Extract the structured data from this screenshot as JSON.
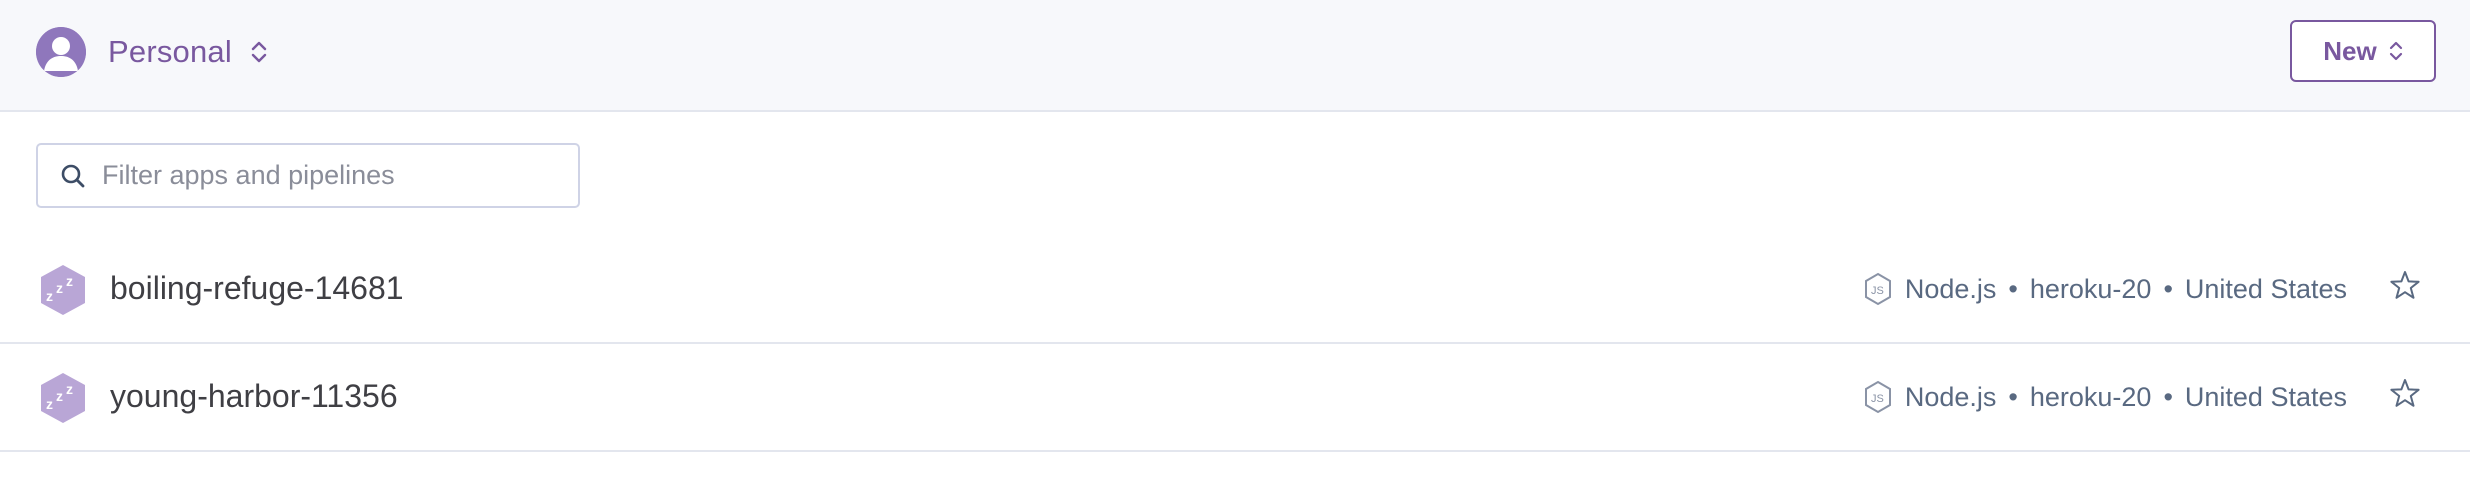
{
  "header": {
    "account_label": "Personal",
    "new_button_label": "New"
  },
  "filter": {
    "placeholder": "Filter apps and pipelines",
    "value": ""
  },
  "apps": [
    {
      "name": "boiling-refuge-14681",
      "language": "Node.js",
      "stack": "heroku-20",
      "region": "United States",
      "language_icon": "nodejs-icon",
      "status_icon": "sleeping-dyno-icon"
    },
    {
      "name": "young-harbor-11356",
      "language": "Node.js",
      "stack": "heroku-20",
      "region": "United States",
      "language_icon": "nodejs-icon",
      "status_icon": "sleeping-dyno-icon"
    }
  ],
  "separator": "•",
  "colors": {
    "brand": "#79589f",
    "avatar": "#8f77bc",
    "meta_text": "#596981",
    "header_bg": "#f7f8fb",
    "divider": "#e3e6ee"
  }
}
